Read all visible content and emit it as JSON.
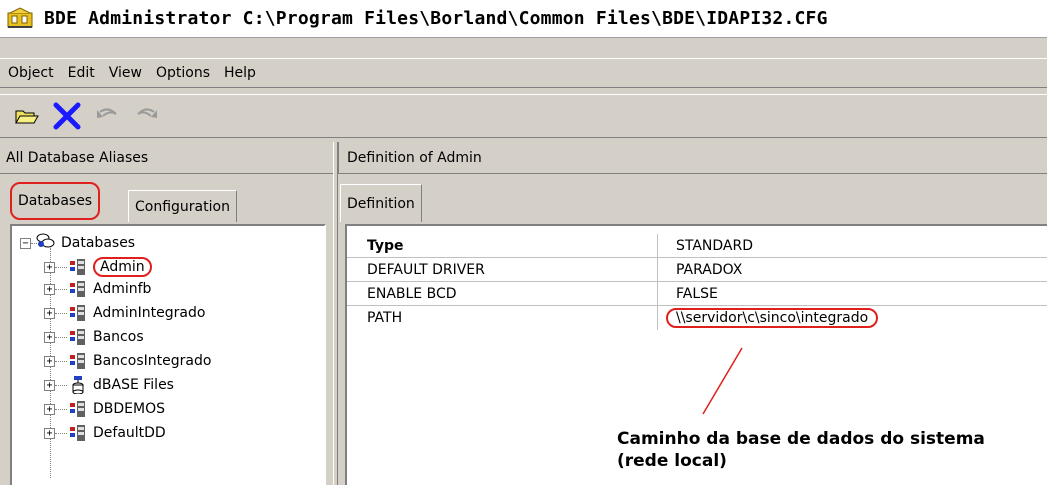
{
  "window": {
    "title": "BDE Administrator  C:\\Program Files\\Borland\\Common Files\\BDE\\IDAPI32.CFG"
  },
  "menu": [
    "Object",
    "Edit",
    "View",
    "Options",
    "Help"
  ],
  "toolbar": {
    "icons": [
      "open-folder-icon",
      "delete-x-icon",
      "undo-icon",
      "redo-icon"
    ],
    "accent_color": "#1a1aff"
  },
  "left_panel": {
    "header": "All Database Aliases",
    "tabs": [
      "Databases",
      "Configuration"
    ],
    "active_tab": "Databases",
    "tree_root": "Databases",
    "tree_items": [
      "Admin",
      "Adminfb",
      "AdminIntegrado",
      "Bancos",
      "BancosIntegrado",
      "dBASE Files",
      "DBDEMOS",
      "DefaultDD"
    ]
  },
  "right_panel": {
    "header": "Definition of Admin",
    "tabs": [
      "Definition"
    ],
    "rows": [
      {
        "key": "Type",
        "value": "STANDARD",
        "bold": true
      },
      {
        "key": "DEFAULT DRIVER",
        "value": "PARADOX"
      },
      {
        "key": "ENABLE BCD",
        "value": "FALSE"
      },
      {
        "key": "PATH",
        "value": "\\\\servidor\\c\\sinco\\integrado"
      }
    ]
  },
  "annotation": {
    "line1": "Caminho da base de dados do sistema",
    "line2": "(rede local)",
    "color": "#e0201c"
  }
}
